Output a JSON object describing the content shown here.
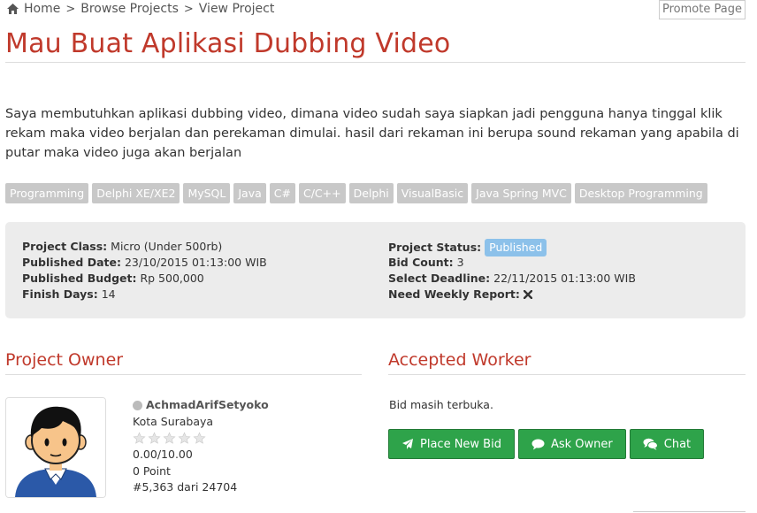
{
  "breadcrumb": {
    "items": [
      {
        "label": "Home",
        "icon": "home-icon"
      },
      {
        "label": "Browse Projects"
      },
      {
        "label": "View Project"
      }
    ],
    "separator": ">"
  },
  "promote_label": "Promote Page",
  "title": "Mau Buat Aplikasi Dubbing Video",
  "description": "Saya membutuhkan aplikasi dubbing video, dimana video sudah saya siapkan jadi pengguna hanya tinggal klik rekam maka video berjalan dan perekaman dimulai. hasil dari rekaman ini berupa sound rekaman yang apabila di putar maka video juga akan berjalan",
  "tags": [
    "Programming",
    "Delphi XE/XE2",
    "MySQL",
    "Java",
    "C#",
    "C/C++",
    "Delphi",
    "VisualBasic",
    "Java Spring MVC",
    "Desktop Programming"
  ],
  "info": {
    "left": [
      {
        "label": "Project Class:",
        "value": "Micro (Under 500rb)"
      },
      {
        "label": "Published Date:",
        "value": "23/10/2015 01:13:00 WIB"
      },
      {
        "label": "Published Budget:",
        "value": "Rp 500,000"
      },
      {
        "label": "Finish Days:",
        "value": "14"
      }
    ],
    "right": {
      "status_label": "Project Status:",
      "status_value": "Published",
      "bid_count_label": "Bid Count:",
      "bid_count_value": "3",
      "deadline_label": "Select Deadline:",
      "deadline_value": "22/11/2015 01:13:00 WIB",
      "weekly_label": "Need Weekly Report:",
      "weekly_icon": "x-icon"
    }
  },
  "owner": {
    "section_title": "Project Owner",
    "name": "AchmadArifSetyoko",
    "city": "Kota Surabaya",
    "rating": "0.00/10.00",
    "rating_stars": 0,
    "points": "0 Point",
    "rank": "#5,363 dari 24704"
  },
  "worker": {
    "section_title": "Accepted Worker",
    "status_text": "Bid masih terbuka."
  },
  "actions": {
    "place_bid": "Place New Bid",
    "ask_owner": "Ask Owner",
    "chat": "Chat"
  },
  "colors": {
    "accent_red": "#c0392b",
    "button_green": "#2ea34a",
    "status_badge_blue": "#8cc1ea",
    "tag_gray": "#c8c8c8"
  }
}
